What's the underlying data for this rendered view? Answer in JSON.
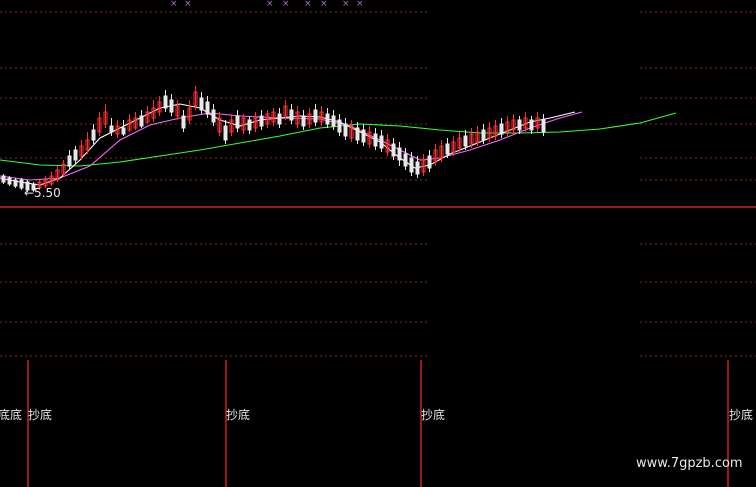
{
  "chart_data": {
    "type": "candlestick",
    "low_marker": "←5.50",
    "signal_label": "抄底",
    "signals": [
      {
        "x": 0,
        "text": "底底"
      },
      {
        "x": 1,
        "text": "抄底"
      },
      {
        "x": 2,
        "text": "抄底"
      },
      {
        "x": 3,
        "text": "抄底"
      },
      {
        "x": 4,
        "text": "抄底"
      }
    ],
    "signal_text_left": "底底",
    "colors": {
      "up": "#ff3030",
      "down": "#e8e8e8",
      "ma_fast": "#ffffff",
      "ma_mid": "#ff66ff",
      "ma_slow": "#33ff33",
      "grid": "#7a2a2a",
      "base": "#d02020"
    }
  },
  "watermark": "www.7gpzb.com"
}
